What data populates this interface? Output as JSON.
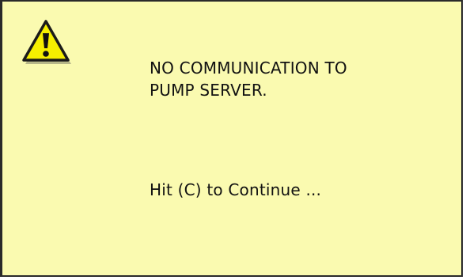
{
  "dialog": {
    "icon": "warning-triangle-icon",
    "message_line1": "NO COMMUNICATION TO",
    "message_line2": "PUMP SERVER.",
    "prompt": "Hit (C) to Continue ..."
  },
  "colors": {
    "background": "#fafab0",
    "icon_fill": "#f5ef00",
    "border": "#2a2a2a",
    "text": "#111111"
  }
}
